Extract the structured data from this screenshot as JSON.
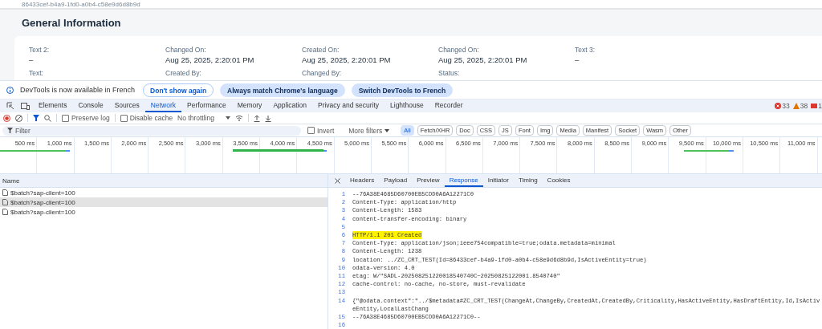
{
  "page": {
    "object_id": "86433cef-b4a9-1fd0-a0b4-c58e9d6d8b9d",
    "section_title": "General Information",
    "field_rows": [
      {
        "fields": [
          {
            "label": "Text 2:",
            "value": "–"
          },
          {
            "label": "Changed On:",
            "value": "Aug 25, 2025, 2:20:01 PM"
          },
          {
            "label": "Created On:",
            "value": "Aug 25, 2025, 2:20:01 PM"
          },
          {
            "label": "Changed On:",
            "value": "Aug 25, 2025, 2:20:01 PM"
          },
          {
            "label": "Text 3:",
            "value": "–"
          }
        ]
      },
      {
        "fields": [
          {
            "label": "Text:"
          },
          {
            "label": "Created By:"
          },
          {
            "label": "Changed By:"
          },
          {
            "label": "Status:"
          }
        ]
      }
    ]
  },
  "infobar": {
    "message": "DevTools is now available in French",
    "buttons": [
      {
        "label": "Don't show again",
        "kind": "outline"
      },
      {
        "label": "Always match Chrome's language",
        "kind": "tonal"
      },
      {
        "label": "Switch DevTools to French",
        "kind": "tonal"
      }
    ]
  },
  "devtools": {
    "tabs": [
      {
        "label": "Elements",
        "selected": false
      },
      {
        "label": "Console",
        "selected": false
      },
      {
        "label": "Sources",
        "selected": false
      },
      {
        "label": "Network",
        "selected": true
      },
      {
        "label": "Performance",
        "selected": false
      },
      {
        "label": "Memory",
        "selected": false
      },
      {
        "label": "Application",
        "selected": false
      },
      {
        "label": "Privacy and security",
        "selected": false
      },
      {
        "label": "Lighthouse",
        "selected": false
      },
      {
        "label": "Recorder",
        "selected": false
      }
    ],
    "counters": [
      {
        "kind": "error",
        "count": "33"
      },
      {
        "kind": "warning",
        "count": "38"
      },
      {
        "kind": "message",
        "count": "1"
      }
    ],
    "toolbar": {
      "recording": true,
      "preserve_log": {
        "label": "Preserve log",
        "checked": false
      },
      "disable_cache": {
        "label": "Disable cache",
        "checked": false
      },
      "throttling": "No throttling"
    },
    "filter": {
      "placeholder": "Filter",
      "invert": {
        "label": "Invert",
        "checked": false
      },
      "more_filters": "More filters",
      "types": [
        {
          "label": "All",
          "selected": true
        },
        {
          "label": "Fetch/XHR",
          "selected": false
        },
        {
          "label": "Doc",
          "selected": false
        },
        {
          "label": "CSS",
          "selected": false
        },
        {
          "label": "JS",
          "selected": false
        },
        {
          "label": "Font",
          "selected": false
        },
        {
          "label": "Img",
          "selected": false
        },
        {
          "label": "Media",
          "selected": false
        },
        {
          "label": "Manifest",
          "selected": false
        },
        {
          "label": "Socket",
          "selected": false
        },
        {
          "label": "Wasm",
          "selected": false
        },
        {
          "label": "Other",
          "selected": false
        }
      ]
    },
    "timeline": {
      "ticks": [
        "500 ms",
        "1,000 ms",
        "1,500 ms",
        "2,000 ms",
        "2,500 ms",
        "3,000 ms",
        "3,500 ms",
        "4,000 ms",
        "4,500 ms",
        "5,000 ms",
        "5,500 ms",
        "6,000 ms",
        "6,500 ms",
        "7,000 ms",
        "7,500 ms",
        "8,000 ms",
        "8,500 ms",
        "9,000 ms",
        "9,500 ms",
        "10,000 ms",
        "10,500 ms",
        "11,000 ms"
      ]
    },
    "requests": {
      "column": "Name",
      "rows": [
        {
          "name": "$batch?sap-client=100",
          "selected": false
        },
        {
          "name": "$batch?sap-client=100",
          "selected": true
        },
        {
          "name": "$batch?sap-client=100",
          "selected": false
        }
      ]
    },
    "detail_tabs": [
      {
        "label": "Headers",
        "selected": false
      },
      {
        "label": "Payload",
        "selected": false
      },
      {
        "label": "Preview",
        "selected": false
      },
      {
        "label": "Response",
        "selected": true
      },
      {
        "label": "Initiator",
        "selected": false
      },
      {
        "label": "Timing",
        "selected": false
      },
      {
        "label": "Cookies",
        "selected": false
      }
    ],
    "response_lines": [
      {
        "number": "1",
        "text": "--76A38E4685D60700EB5CDD0A6A12271C0",
        "highlighted": false
      },
      {
        "number": "2",
        "text": "Content-Type: application/http",
        "highlighted": false
      },
      {
        "number": "3",
        "text": "Content-Length: 1583",
        "highlighted": false
      },
      {
        "number": "4",
        "text": "content-transfer-encoding: binary",
        "highlighted": false
      },
      {
        "number": "5",
        "highlighted": false
      },
      {
        "number": "6",
        "text": "HTTP/1.1 201 Created",
        "highlighted": true
      },
      {
        "number": "7",
        "text": "Content-Type: application/json;ieee754compatible=true;odata.metadata=minimal",
        "highlighted": false
      },
      {
        "number": "8",
        "text": "Content-Length: 1238",
        "highlighted": false
      },
      {
        "number": "9",
        "text": "location: ../ZC_CRT_TEST(Id=86433cef-b4a9-1fd0-a0b4-c58e9d6d8b9d,IsActiveEntity=true)",
        "highlighted": false
      },
      {
        "number": "10",
        "text": "odata-version: 4.0",
        "highlighted": false
      },
      {
        "number": "11",
        "text": "etag: W/\"SADL-202508251220018540740C~20250825122001.8540740\"",
        "highlighted": false
      },
      {
        "number": "12",
        "text": "cache-control: no-cache, no-store, must-revalidate",
        "highlighted": false
      },
      {
        "number": "13",
        "highlighted": false
      },
      {
        "number": "14",
        "text": "{\"@odata.context\":\"../$metadata#ZC_CRT_TEST(ChangeAt,ChangeBy,CreatedAt,CreatedBy,Criticality,HasActiveEntity,HasDraftEntity,Id,IsActiveEntity,LocalLastChang",
        "highlighted": false
      },
      {
        "number": "15",
        "text": "--76A38E4685D60700EB5CDD0A6A12271C0--",
        "highlighted": false
      },
      {
        "number": "16",
        "highlighted": false
      }
    ]
  }
}
